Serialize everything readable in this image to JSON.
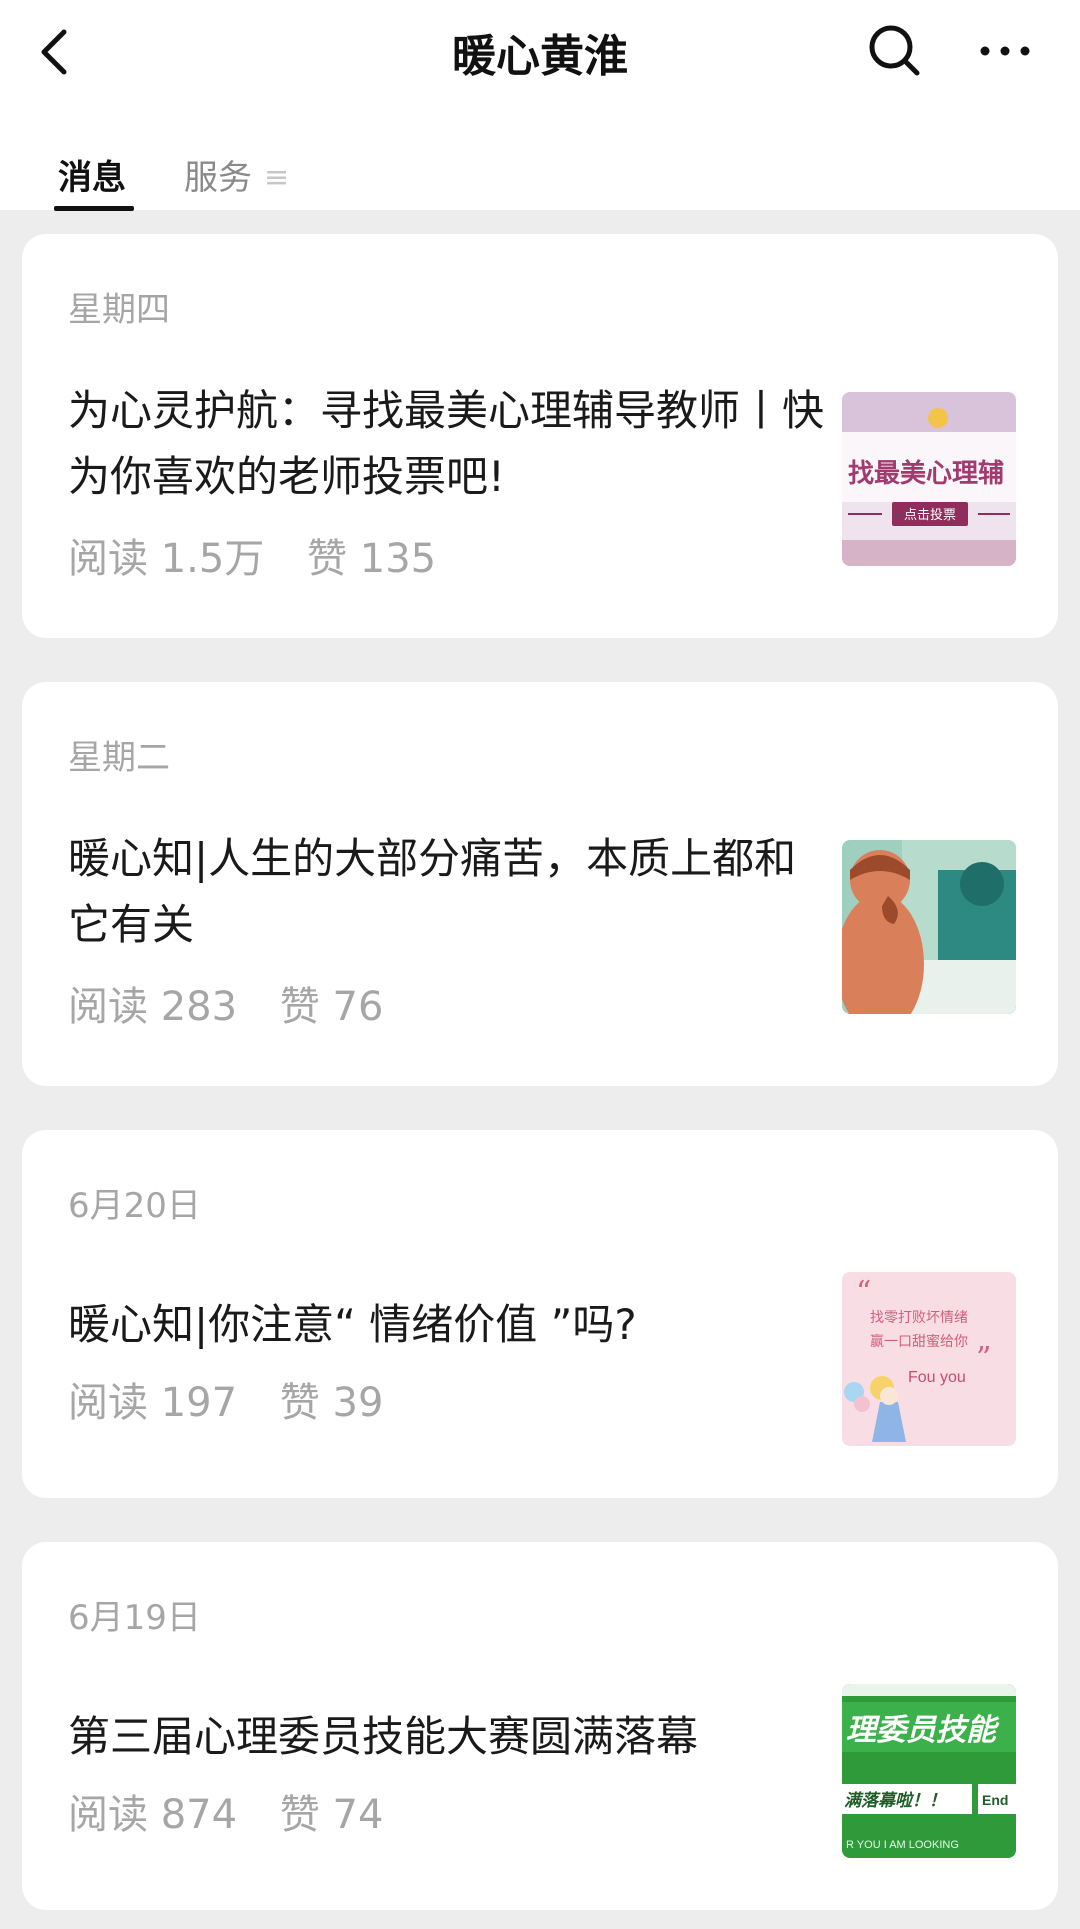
{
  "header": {
    "title": "暖心黄淮",
    "back_icon": "chevron-left-icon",
    "search_icon": "search-icon",
    "more_icon": "more-horizontal-icon"
  },
  "tabs": [
    {
      "label": "消息",
      "active": true
    },
    {
      "label": "服务",
      "active": false,
      "menu_glyph": "≡"
    }
  ],
  "articles": [
    {
      "date": "星期四",
      "title": "为心灵护航：寻找最美心理辅导教师丨快为你喜欢的老师投票吧!",
      "reads_label": "阅读 1.5万",
      "likes_label": "赞 135",
      "thumb": {
        "line1": "找最美心理辅",
        "button": "点击投票"
      }
    },
    {
      "date": "星期二",
      "title": "暖心知|人生的大部分痛苦，本质上都和它有关",
      "reads_label": "阅读 283",
      "likes_label": "赞 76",
      "thumb": {}
    },
    {
      "date": "6月20日",
      "title": "暖心知|你注意“ 情绪价值 ”吗?",
      "reads_label": "阅读 197",
      "likes_label": "赞 39",
      "thumb": {
        "line1": "找零打败坏情绪",
        "line2": "赢一口甜蜜给你",
        "line3": "Fou you"
      }
    },
    {
      "date": "6月19日",
      "title": "第三届心理委员技能大赛圆满落幕",
      "reads_label": "阅读 874",
      "likes_label": "赞 74",
      "thumb": {
        "line1": "理委员技能",
        "line2": "满落幕啦！！",
        "line3": "End",
        "line4": "R YOU I AM LOOKING"
      }
    }
  ]
}
